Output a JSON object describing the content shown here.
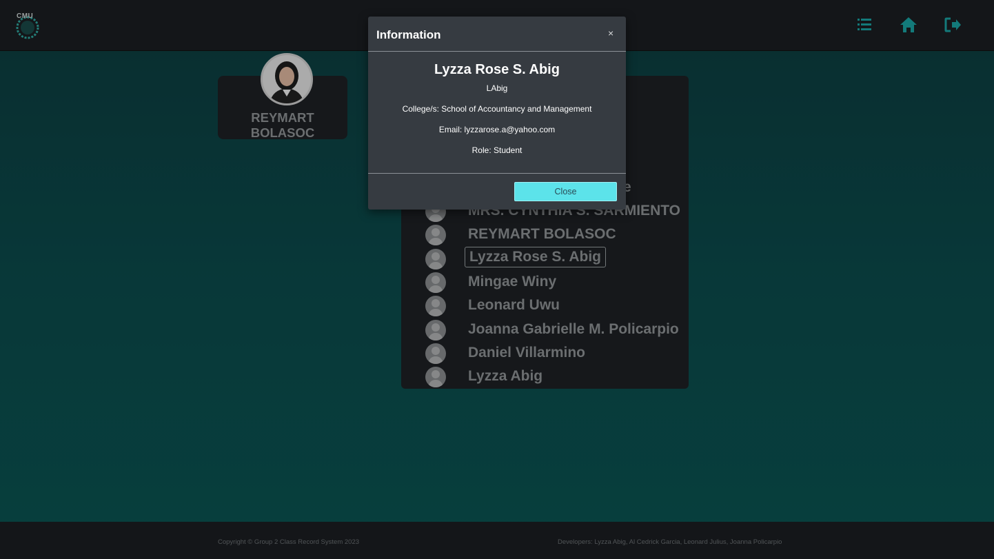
{
  "header": {
    "logo_text": "CMU",
    "nav_icons": [
      "list-icon",
      "home-icon",
      "logout-icon"
    ],
    "accent": "#1aa3a3"
  },
  "profile": {
    "name": "REYMART BOLASOC"
  },
  "list": {
    "items": [
      {
        "name": "MRS. CYNTHIA S. SARMIENTO"
      },
      {
        "name": "REYMART BOLASOC"
      },
      {
        "name": "Lyzza Rose S. Abig"
      },
      {
        "name": "Mingae Winy"
      },
      {
        "name": "Leonard Uwu"
      },
      {
        "name": "Joanna Gabrielle M. Policarpio"
      },
      {
        "name": "Daniel Villarmino"
      },
      {
        "name": "Lyzza Abig"
      }
    ],
    "partial_item_tail": "e"
  },
  "modal": {
    "title": "Information",
    "close_x": "×",
    "name": "Lyzza Rose S. Abig",
    "username": "LAbig",
    "college": "College/s: School of Accountancy and Management",
    "email": "Email: lyzzarose.a@yahoo.com",
    "role": "Role: Student",
    "close_button": "Close"
  },
  "footer": {
    "copyright": "Copyright © Group 2 Class Record System 2023",
    "developers": "Developers: Lyzza Abig, Al Cedrick Garcia, Leonard Julius, Joanna Policarpio"
  }
}
